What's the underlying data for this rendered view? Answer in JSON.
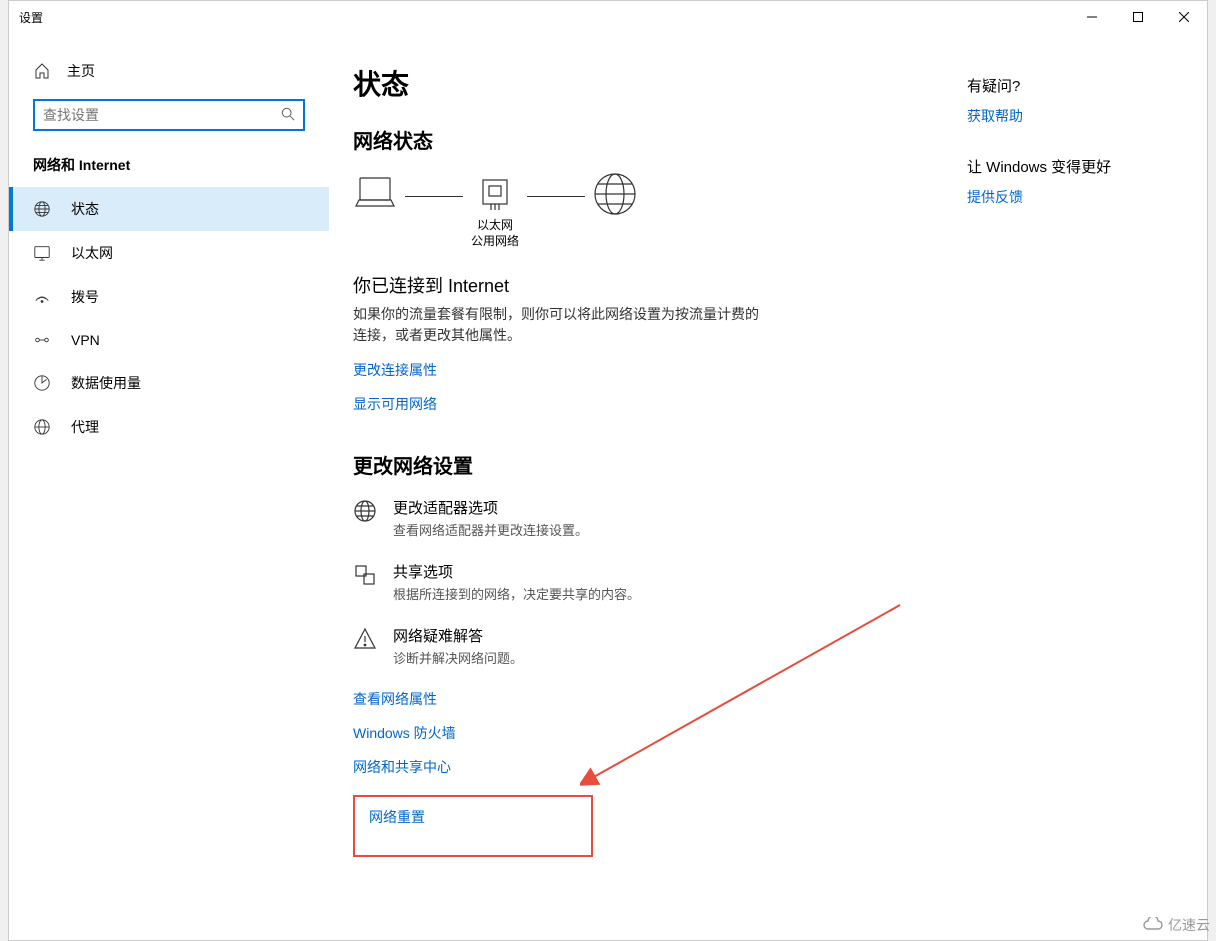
{
  "window": {
    "title": "设置"
  },
  "sidebar": {
    "home": "主页",
    "search_placeholder": "查找设置",
    "section": "网络和 Internet",
    "items": [
      {
        "label": "状态"
      },
      {
        "label": "以太网"
      },
      {
        "label": "拨号"
      },
      {
        "label": "VPN"
      },
      {
        "label": "数据使用量"
      },
      {
        "label": "代理"
      }
    ]
  },
  "main": {
    "title": "状态",
    "net_status_heading": "网络状态",
    "diagram": {
      "eth": "以太网",
      "pub": "公用网络"
    },
    "connected_title": "你已连接到 Internet",
    "connected_desc": "如果你的流量套餐有限制，则你可以将此网络设置为按流量计费的连接，或者更改其他属性。",
    "link_change_props": "更改连接属性",
    "link_show_networks": "显示可用网络",
    "change_heading": "更改网络设置",
    "settings": [
      {
        "title": "更改适配器选项",
        "desc": "查看网络适配器并更改连接设置。"
      },
      {
        "title": "共享选项",
        "desc": "根据所连接到的网络，决定要共享的内容。"
      },
      {
        "title": "网络疑难解答",
        "desc": "诊断并解决网络问题。"
      }
    ],
    "link_view_props": "查看网络属性",
    "link_firewall": "Windows 防火墙",
    "link_sharing_center": "网络和共享中心",
    "link_reset": "网络重置"
  },
  "aside": {
    "q_heading": "有疑问?",
    "help_link": "获取帮助",
    "fb_heading": "让 Windows 变得更好",
    "fb_link": "提供反馈"
  },
  "watermark": "亿速云"
}
